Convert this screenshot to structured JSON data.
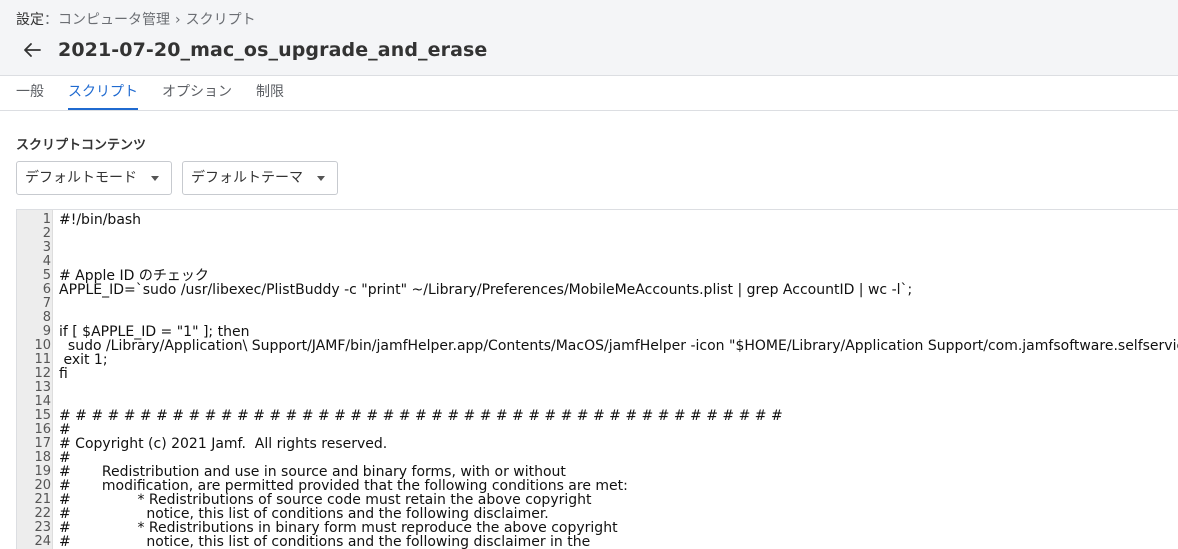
{
  "breadcrumb": {
    "root": "設定",
    "colon": "：",
    "section": "コンピュータ管理",
    "separator": "›",
    "current": "スクリプト"
  },
  "page_title": "2021-07-20_mac_os_upgrade_and_erase",
  "back_icon": "arrow-left-icon",
  "tabs": [
    {
      "label": "一般",
      "active": false
    },
    {
      "label": "スクリプト",
      "active": true
    },
    {
      "label": "オプション",
      "active": false
    },
    {
      "label": "制限",
      "active": false
    }
  ],
  "script_contents": {
    "label": "スクリプトコンテンツ",
    "mode_select": "デフォルトモード",
    "theme_select": "デフォルトテーマ"
  },
  "colors": {
    "accent": "#1f6ad0",
    "header_bg": "#f4f5f7",
    "gutter_bg": "#ededed"
  },
  "code_lines": [
    "#!/bin/bash",
    "",
    "",
    "",
    "# Apple ID のチェック",
    "APPLE_ID=`sudo /usr/libexec/PlistBuddy -c \"print\" ~/Library/Preferences/MobileMeAccounts.plist | grep AccountID | wc -l`;",
    "",
    "",
    "if [ $APPLE_ID = \"1\" ]; then",
    "  sudo /Library/Application\\ Support/JAMF/bin/jamfHelper.app/Contents/MacOS/jamfHelper -icon \"$HOME/Library/Application Support/com.jamfsoftware.selfservic",
    " exit 1;",
    "fi",
    "",
    "",
    "# # # # # # # # # # # # # # # # # # # # # # # # # # # # # # # # # # # # # # # # # # # # #",
    "#",
    "# Copyright (c) 2021 Jamf.  All rights reserved.",
    "#",
    "#       Redistribution and use in source and binary forms, with or without",
    "#       modification, are permitted provided that the following conditions are met:",
    "#               * Redistributions of source code must retain the above copyright",
    "#                 notice, this list of conditions and the following disclaimer.",
    "#               * Redistributions in binary form must reproduce the above copyright",
    "#                 notice, this list of conditions and the following disclaimer in the"
  ]
}
